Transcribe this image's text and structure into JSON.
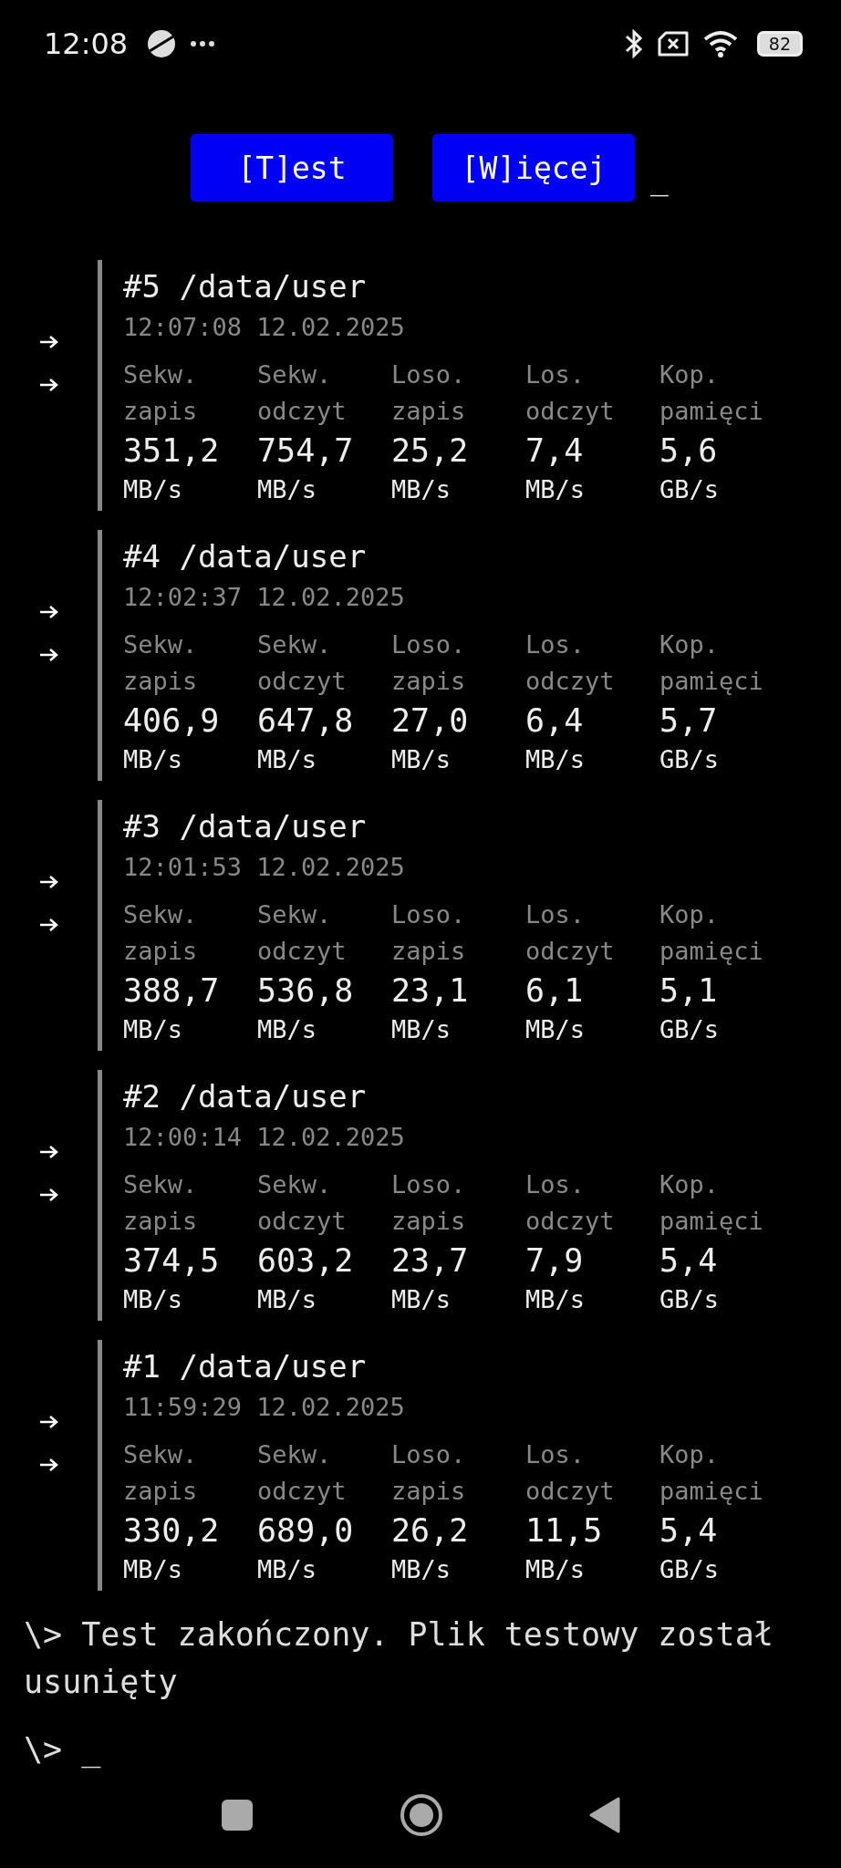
{
  "status_bar": {
    "time": "12:08",
    "battery": "82"
  },
  "buttons": [
    {
      "label": "[T]est"
    },
    {
      "label": "[W]ięcej"
    }
  ],
  "cursor": "_",
  "results": [
    {
      "title": "#5 /data/user",
      "timestamp": "12:07:08 12.02.2025",
      "metrics": [
        {
          "label1": "Sekw.",
          "label2": "zapis",
          "value": "351,2",
          "unit": "MB/s"
        },
        {
          "label1": "Sekw.",
          "label2": "odczyt",
          "value": "754,7",
          "unit": "MB/s"
        },
        {
          "label1": "Loso.",
          "label2": "zapis",
          "value": "25,2",
          "unit": "MB/s"
        },
        {
          "label1": "Los.",
          "label2": "odczyt",
          "value": "7,4",
          "unit": "MB/s"
        },
        {
          "label1": "Kop.",
          "label2": "pamięci",
          "value": "5,6",
          "unit": "GB/s"
        }
      ]
    },
    {
      "title": "#4 /data/user",
      "timestamp": "12:02:37 12.02.2025",
      "metrics": [
        {
          "label1": "Sekw.",
          "label2": "zapis",
          "value": "406,9",
          "unit": "MB/s"
        },
        {
          "label1": "Sekw.",
          "label2": "odczyt",
          "value": "647,8",
          "unit": "MB/s"
        },
        {
          "label1": "Loso.",
          "label2": "zapis",
          "value": "27,0",
          "unit": "MB/s"
        },
        {
          "label1": "Los.",
          "label2": "odczyt",
          "value": "6,4",
          "unit": "MB/s"
        },
        {
          "label1": "Kop.",
          "label2": "pamięci",
          "value": "5,7",
          "unit": "GB/s"
        }
      ]
    },
    {
      "title": "#3 /data/user",
      "timestamp": "12:01:53 12.02.2025",
      "metrics": [
        {
          "label1": "Sekw.",
          "label2": "zapis",
          "value": "388,7",
          "unit": "MB/s"
        },
        {
          "label1": "Sekw.",
          "label2": "odczyt",
          "value": "536,8",
          "unit": "MB/s"
        },
        {
          "label1": "Loso.",
          "label2": "zapis",
          "value": "23,1",
          "unit": "MB/s"
        },
        {
          "label1": "Los.",
          "label2": "odczyt",
          "value": "6,1",
          "unit": "MB/s"
        },
        {
          "label1": "Kop.",
          "label2": "pamięci",
          "value": "5,1",
          "unit": "GB/s"
        }
      ]
    },
    {
      "title": "#2 /data/user",
      "timestamp": "12:00:14 12.02.2025",
      "metrics": [
        {
          "label1": "Sekw.",
          "label2": "zapis",
          "value": "374,5",
          "unit": "MB/s"
        },
        {
          "label1": "Sekw.",
          "label2": "odczyt",
          "value": "603,2",
          "unit": "MB/s"
        },
        {
          "label1": "Loso.",
          "label2": "zapis",
          "value": "23,7",
          "unit": "MB/s"
        },
        {
          "label1": "Los.",
          "label2": "odczyt",
          "value": "7,9",
          "unit": "MB/s"
        },
        {
          "label1": "Kop.",
          "label2": "pamięci",
          "value": "5,4",
          "unit": "GB/s"
        }
      ]
    },
    {
      "title": "#1 /data/user",
      "timestamp": "11:59:29 12.02.2025",
      "metrics": [
        {
          "label1": "Sekw.",
          "label2": "zapis",
          "value": "330,2",
          "unit": "MB/s"
        },
        {
          "label1": "Sekw.",
          "label2": "odczyt",
          "value": "689,0",
          "unit": "MB/s"
        },
        {
          "label1": "Loso.",
          "label2": "zapis",
          "value": "26,2",
          "unit": "MB/s"
        },
        {
          "label1": "Los.",
          "label2": "odczyt",
          "value": "11,5",
          "unit": "MB/s"
        },
        {
          "label1": "Kop.",
          "label2": "pamięci",
          "value": "5,4",
          "unit": "GB/s"
        }
      ]
    }
  ],
  "log": [
    {
      "prompt": "\\>",
      "text": "Test zakończony. Plik testowy został usunięty"
    }
  ],
  "input_line": {
    "prompt": "\\>",
    "cursor": "_"
  }
}
